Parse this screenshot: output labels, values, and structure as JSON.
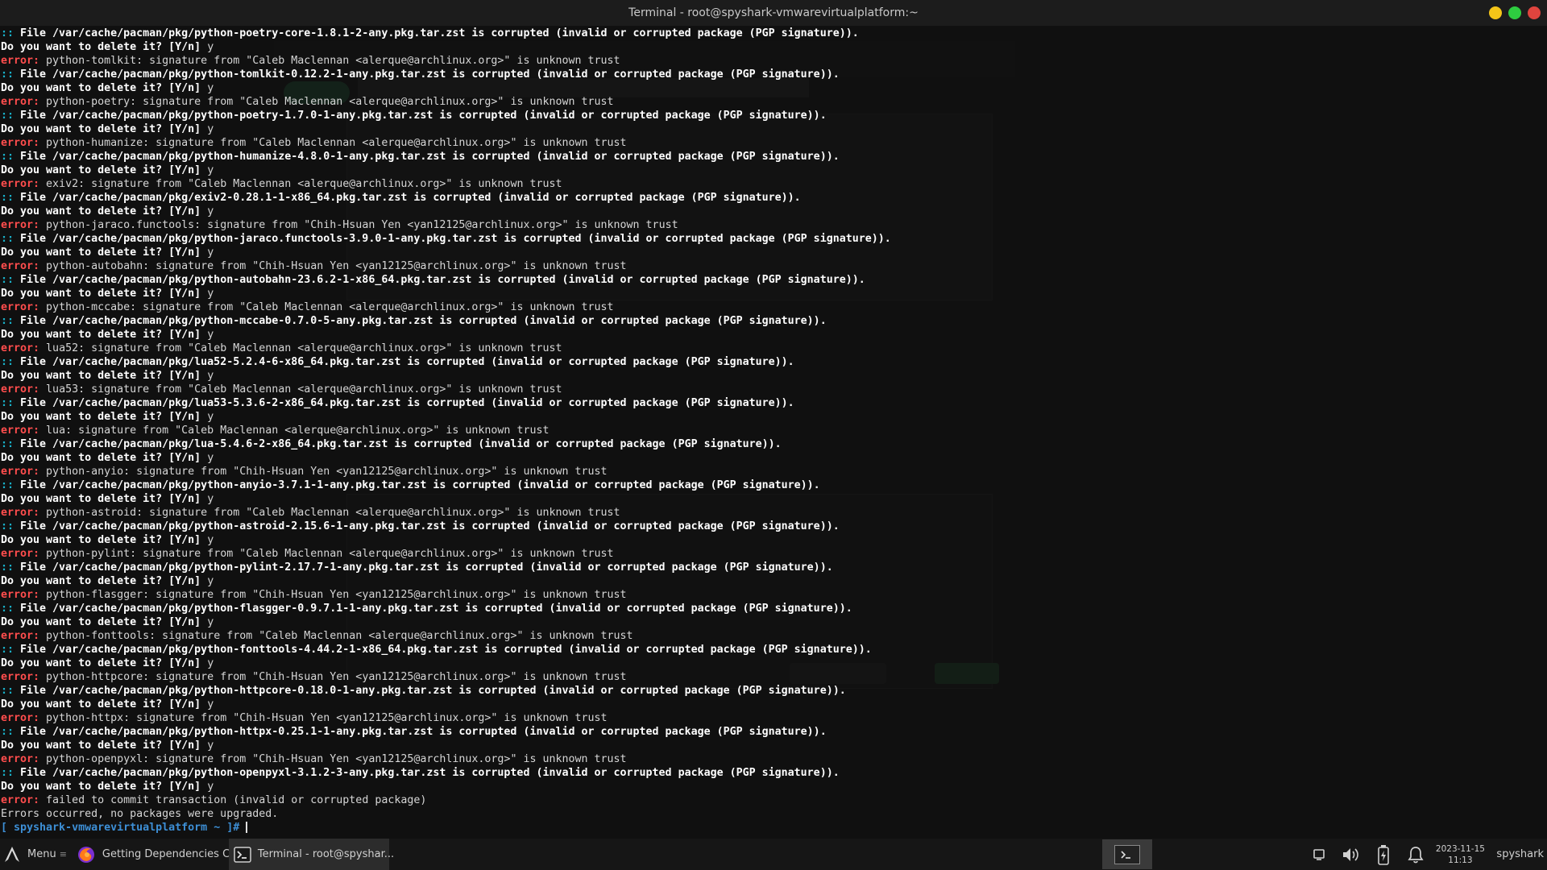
{
  "window": {
    "title": "Terminal - root@spyshark-vmwarevirtualplatform:~",
    "buttons": {
      "minimize_color": "#f5c518",
      "maximize_color": "#2ecc40",
      "close_color": "#e0443e"
    }
  },
  "terminal": {
    "colors": {
      "error": "#ff4d4d",
      "path_prefix": "#19b0c8",
      "prompt": "#3d8fd6"
    },
    "lines": [
      {
        "type": "file",
        "prefix": "::",
        "text": " File /var/cache/pacman/pkg/python-poetry-core-1.8.1-2-any.pkg.tar.zst is corrupted (invalid or corrupted package (PGP signature))."
      },
      {
        "type": "ask",
        "text": "Do you want to delete it? [Y/n] ",
        "answer": "y"
      },
      {
        "type": "error",
        "prefix": "error:",
        "text": " python-tomlkit: signature from \"Caleb Maclennan <alerque@archlinux.org>\" is unknown trust"
      },
      {
        "type": "file",
        "prefix": "::",
        "text": " File /var/cache/pacman/pkg/python-tomlkit-0.12.2-1-any.pkg.tar.zst is corrupted (invalid or corrupted package (PGP signature))."
      },
      {
        "type": "ask",
        "text": "Do you want to delete it? [Y/n] ",
        "answer": "y"
      },
      {
        "type": "error",
        "prefix": "error:",
        "text": " python-poetry: signature from \"Caleb Maclennan <alerque@archlinux.org>\" is unknown trust"
      },
      {
        "type": "file",
        "prefix": "::",
        "text": " File /var/cache/pacman/pkg/python-poetry-1.7.0-1-any.pkg.tar.zst is corrupted (invalid or corrupted package (PGP signature))."
      },
      {
        "type": "ask",
        "text": "Do you want to delete it? [Y/n] ",
        "answer": "y"
      },
      {
        "type": "error",
        "prefix": "error:",
        "text": " python-humanize: signature from \"Caleb Maclennan <alerque@archlinux.org>\" is unknown trust"
      },
      {
        "type": "file",
        "prefix": "::",
        "text": " File /var/cache/pacman/pkg/python-humanize-4.8.0-1-any.pkg.tar.zst is corrupted (invalid or corrupted package (PGP signature))."
      },
      {
        "type": "ask",
        "text": "Do you want to delete it? [Y/n] ",
        "answer": "y"
      },
      {
        "type": "error",
        "prefix": "error:",
        "text": " exiv2: signature from \"Caleb Maclennan <alerque@archlinux.org>\" is unknown trust"
      },
      {
        "type": "file",
        "prefix": "::",
        "text": " File /var/cache/pacman/pkg/exiv2-0.28.1-1-x86_64.pkg.tar.zst is corrupted (invalid or corrupted package (PGP signature))."
      },
      {
        "type": "ask",
        "text": "Do you want to delete it? [Y/n] ",
        "answer": "y"
      },
      {
        "type": "error",
        "prefix": "error:",
        "text": " python-jaraco.functools: signature from \"Chih-Hsuan Yen <yan12125@archlinux.org>\" is unknown trust"
      },
      {
        "type": "file",
        "prefix": "::",
        "text": " File /var/cache/pacman/pkg/python-jaraco.functools-3.9.0-1-any.pkg.tar.zst is corrupted (invalid or corrupted package (PGP signature))."
      },
      {
        "type": "ask",
        "text": "Do you want to delete it? [Y/n] ",
        "answer": "y"
      },
      {
        "type": "error",
        "prefix": "error:",
        "text": " python-autobahn: signature from \"Chih-Hsuan Yen <yan12125@archlinux.org>\" is unknown trust"
      },
      {
        "type": "file",
        "prefix": "::",
        "text": " File /var/cache/pacman/pkg/python-autobahn-23.6.2-1-x86_64.pkg.tar.zst is corrupted (invalid or corrupted package (PGP signature))."
      },
      {
        "type": "ask",
        "text": "Do you want to delete it? [Y/n] ",
        "answer": "y"
      },
      {
        "type": "error",
        "prefix": "error:",
        "text": " python-mccabe: signature from \"Caleb Maclennan <alerque@archlinux.org>\" is unknown trust"
      },
      {
        "type": "file",
        "prefix": "::",
        "text": " File /var/cache/pacman/pkg/python-mccabe-0.7.0-5-any.pkg.tar.zst is corrupted (invalid or corrupted package (PGP signature))."
      },
      {
        "type": "ask",
        "text": "Do you want to delete it? [Y/n] ",
        "answer": "y"
      },
      {
        "type": "error",
        "prefix": "error:",
        "text": " lua52: signature from \"Caleb Maclennan <alerque@archlinux.org>\" is unknown trust"
      },
      {
        "type": "file",
        "prefix": "::",
        "text": " File /var/cache/pacman/pkg/lua52-5.2.4-6-x86_64.pkg.tar.zst is corrupted (invalid or corrupted package (PGP signature))."
      },
      {
        "type": "ask",
        "text": "Do you want to delete it? [Y/n] ",
        "answer": "y"
      },
      {
        "type": "error",
        "prefix": "error:",
        "text": " lua53: signature from \"Caleb Maclennan <alerque@archlinux.org>\" is unknown trust"
      },
      {
        "type": "file",
        "prefix": "::",
        "text": " File /var/cache/pacman/pkg/lua53-5.3.6-2-x86_64.pkg.tar.zst is corrupted (invalid or corrupted package (PGP signature))."
      },
      {
        "type": "ask",
        "text": "Do you want to delete it? [Y/n] ",
        "answer": "y"
      },
      {
        "type": "error",
        "prefix": "error:",
        "text": " lua: signature from \"Caleb Maclennan <alerque@archlinux.org>\" is unknown trust"
      },
      {
        "type": "file",
        "prefix": "::",
        "text": " File /var/cache/pacman/pkg/lua-5.4.6-2-x86_64.pkg.tar.zst is corrupted (invalid or corrupted package (PGP signature))."
      },
      {
        "type": "ask",
        "text": "Do you want to delete it? [Y/n] ",
        "answer": "y"
      },
      {
        "type": "error",
        "prefix": "error:",
        "text": " python-anyio: signature from \"Chih-Hsuan Yen <yan12125@archlinux.org>\" is unknown trust"
      },
      {
        "type": "file",
        "prefix": "::",
        "text": " File /var/cache/pacman/pkg/python-anyio-3.7.1-1-any.pkg.tar.zst is corrupted (invalid or corrupted package (PGP signature))."
      },
      {
        "type": "ask",
        "text": "Do you want to delete it? [Y/n] ",
        "answer": "y"
      },
      {
        "type": "error",
        "prefix": "error:",
        "text": " python-astroid: signature from \"Caleb Maclennan <alerque@archlinux.org>\" is unknown trust"
      },
      {
        "type": "file",
        "prefix": "::",
        "text": " File /var/cache/pacman/pkg/python-astroid-2.15.6-1-any.pkg.tar.zst is corrupted (invalid or corrupted package (PGP signature))."
      },
      {
        "type": "ask",
        "text": "Do you want to delete it? [Y/n] ",
        "answer": "y"
      },
      {
        "type": "error",
        "prefix": "error:",
        "text": " python-pylint: signature from \"Caleb Maclennan <alerque@archlinux.org>\" is unknown trust"
      },
      {
        "type": "file",
        "prefix": "::",
        "text": " File /var/cache/pacman/pkg/python-pylint-2.17.7-1-any.pkg.tar.zst is corrupted (invalid or corrupted package (PGP signature))."
      },
      {
        "type": "ask",
        "text": "Do you want to delete it? [Y/n] ",
        "answer": "y"
      },
      {
        "type": "error",
        "prefix": "error:",
        "text": " python-flasgger: signature from \"Chih-Hsuan Yen <yan12125@archlinux.org>\" is unknown trust"
      },
      {
        "type": "file",
        "prefix": "::",
        "text": " File /var/cache/pacman/pkg/python-flasgger-0.9.7.1-1-any.pkg.tar.zst is corrupted (invalid or corrupted package (PGP signature))."
      },
      {
        "type": "ask",
        "text": "Do you want to delete it? [Y/n] ",
        "answer": "y"
      },
      {
        "type": "error",
        "prefix": "error:",
        "text": " python-fonttools: signature from \"Caleb Maclennan <alerque@archlinux.org>\" is unknown trust"
      },
      {
        "type": "file",
        "prefix": "::",
        "text": " File /var/cache/pacman/pkg/python-fonttools-4.44.2-1-x86_64.pkg.tar.zst is corrupted (invalid or corrupted package (PGP signature))."
      },
      {
        "type": "ask",
        "text": "Do you want to delete it? [Y/n] ",
        "answer": "y"
      },
      {
        "type": "error",
        "prefix": "error:",
        "text": " python-httpcore: signature from \"Chih-Hsuan Yen <yan12125@archlinux.org>\" is unknown trust"
      },
      {
        "type": "file",
        "prefix": "::",
        "text": " File /var/cache/pacman/pkg/python-httpcore-0.18.0-1-any.pkg.tar.zst is corrupted (invalid or corrupted package (PGP signature))."
      },
      {
        "type": "ask",
        "text": "Do you want to delete it? [Y/n] ",
        "answer": "y"
      },
      {
        "type": "error",
        "prefix": "error:",
        "text": " python-httpx: signature from \"Chih-Hsuan Yen <yan12125@archlinux.org>\" is unknown trust"
      },
      {
        "type": "file",
        "prefix": "::",
        "text": " File /var/cache/pacman/pkg/python-httpx-0.25.1-1-any.pkg.tar.zst is corrupted (invalid or corrupted package (PGP signature))."
      },
      {
        "type": "ask",
        "text": "Do you want to delete it? [Y/n] ",
        "answer": "y"
      },
      {
        "type": "error",
        "prefix": "error:",
        "text": " python-openpyxl: signature from \"Chih-Hsuan Yen <yan12125@archlinux.org>\" is unknown trust"
      },
      {
        "type": "file",
        "prefix": "::",
        "text": " File /var/cache/pacman/pkg/python-openpyxl-3.1.2-3-any.pkg.tar.zst is corrupted (invalid or corrupted package (PGP signature))."
      },
      {
        "type": "ask",
        "text": "Do you want to delete it? [Y/n] ",
        "answer": "y"
      },
      {
        "type": "error",
        "prefix": "error:",
        "text": " failed to commit transaction (invalid or corrupted package)"
      },
      {
        "type": "plain",
        "text": "Errors occurred, no packages were upgraded."
      },
      {
        "type": "prompt",
        "open": "[ ",
        "host": "spyshark-vmwarevirtualplatform",
        "rest": " ~ ]# "
      }
    ]
  },
  "taskbar": {
    "menu_label": "Menu",
    "apps": [
      {
        "label": "Getting Dependencies C...",
        "icon": "firefox-icon"
      },
      {
        "label": "Terminal - root@spyshar...",
        "icon": "terminal-icon"
      }
    ],
    "clock": {
      "date": "2023-11-15",
      "time": "11:13"
    },
    "user": "spyshark"
  }
}
